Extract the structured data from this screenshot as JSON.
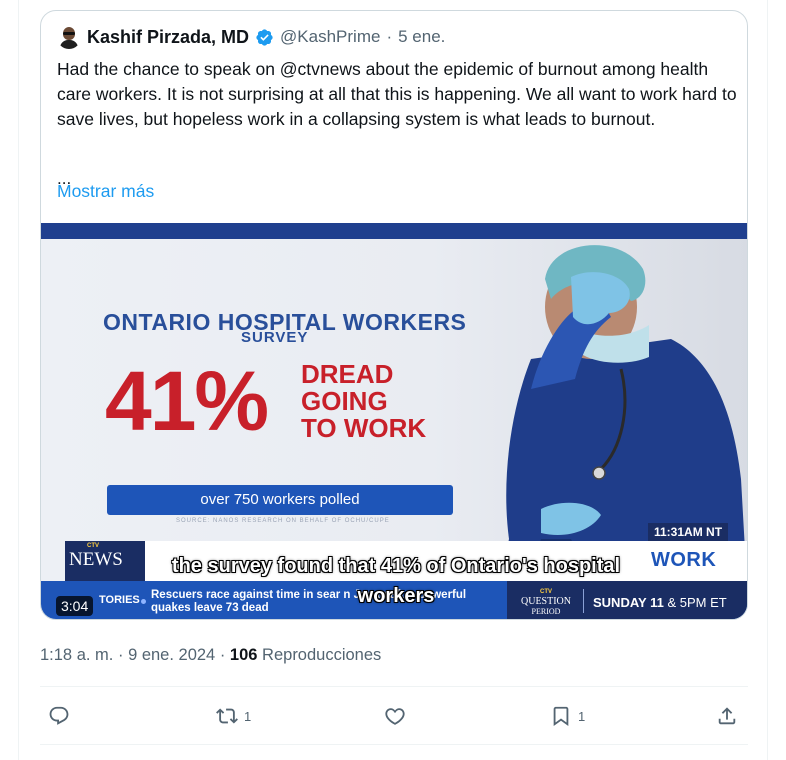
{
  "tweet": {
    "author_name": "Kashif Pirzada, MD",
    "handle": "@KashPrime",
    "separator": "·",
    "date_short": "5 ene.",
    "text": "Had the chance to speak on @ctvnews about the epidemic of burnout among health care workers.  It is not surprising at all that this is happening.  We all want to work hard to save lives, but hopeless work in a collapsing system is what leads to burnout.",
    "ellipsis": "...",
    "show_more": "Mostrar más"
  },
  "video": {
    "survey_title": "ONTARIO HOSPITAL WORKERS",
    "survey_sub": "SURVEY",
    "percent": "41%",
    "dread_lines": [
      "DREAD",
      "GOING",
      "TO WORK"
    ],
    "polled": "over 750 workers polled",
    "source": "SOURCE: NANOS RESEARCH ON BEHALF OF OCHU/CUPE",
    "time_bug": "11:31AM NT",
    "network_small": "CTV",
    "network": "NEWS",
    "lower_third_visible": "WORK",
    "ticker_label": "TORIES",
    "ticker_text": "Rescuers race against time in sear                        n Japan after powerful quakes leave 73 dead",
    "qp_logo_top": "CTV",
    "qp_logo": "QUESTION",
    "qp_logo_bottom": "PERIOD",
    "qp_day": "SUNDAY 11",
    "qp_and": " & 5",
    "qp_pm": "PM ET",
    "caption_line1": "the survey found that 41% of Ontario's hospital",
    "caption_line2": "workers",
    "duration": "3:04"
  },
  "meta": {
    "time": "1:18 a. m.",
    "sep": "·",
    "date": "9 ene. 2024",
    "views_count": "106",
    "views_label": "Reproducciones"
  },
  "actions": {
    "reply_count": "",
    "retweet_count": "1",
    "like_count": "",
    "bookmark_count": "1"
  },
  "colors": {
    "link": "#1d9bf0",
    "muted": "#536471",
    "ctv_blue": "#1e55b8",
    "alert_red": "#c8202a"
  }
}
